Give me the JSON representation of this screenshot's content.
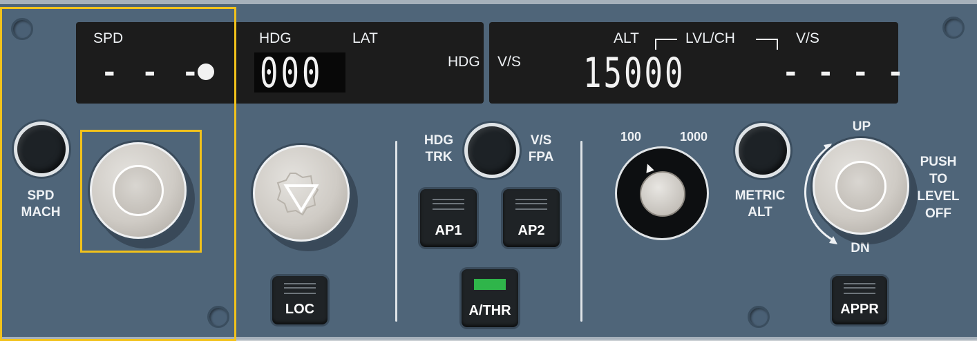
{
  "display": {
    "spd_label": "SPD",
    "spd_value": "- - -",
    "hdg_label": "HDG",
    "lat_label": "LAT",
    "hdg_value": "000",
    "hdg_right_label": "HDG",
    "vs_left_label": "V/S",
    "alt_label": "ALT",
    "lvlch_label": "LVL/CH",
    "vs_label": "V/S",
    "alt_value": "15000",
    "vs_value": "- - - -"
  },
  "buttons": {
    "spd_mach": "SPD\nMACH",
    "hdg_trk": "HDG\nTRK",
    "vs_fpa": "V/S\nFPA",
    "metric_alt": "METRIC\nALT",
    "ap1": "AP1",
    "ap2": "AP2",
    "athr": "A/THR",
    "loc": "LOC",
    "appr": "APPR"
  },
  "alt_knob": {
    "scale_100": "100",
    "scale_1000": "1000",
    "up": "UP",
    "dn": "DN",
    "push_to_level_off": "PUSH\nTO\nLEVEL\nOFF"
  },
  "colors": {
    "panel": "#4f6579",
    "highlight": "#f2c21b",
    "athr_active": "#2fb54a"
  }
}
